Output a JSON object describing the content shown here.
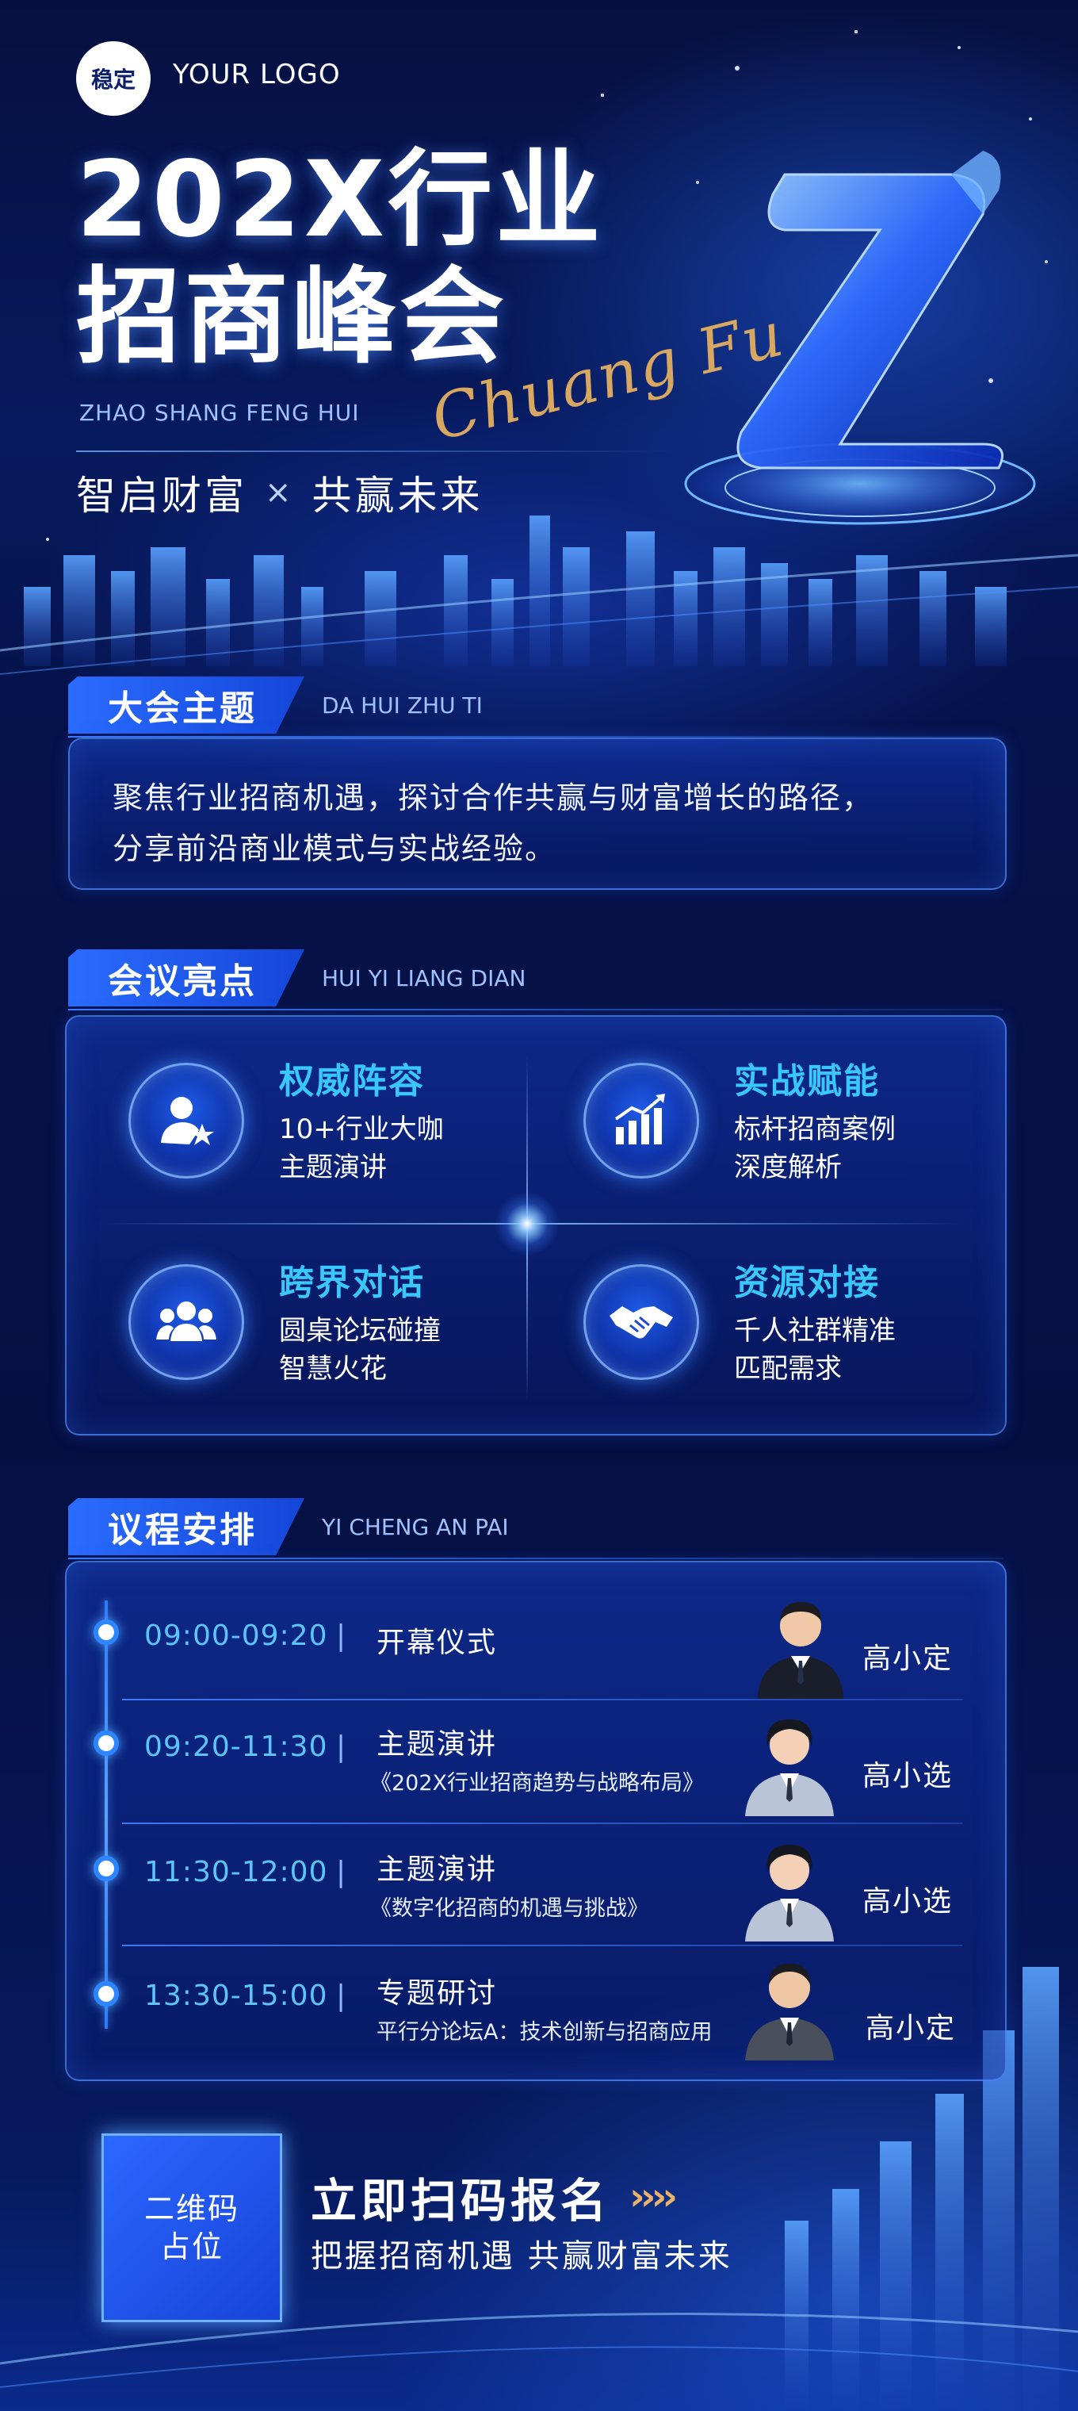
{
  "header": {
    "logo_badge": "稳定",
    "logo_text": "YOUR LOGO",
    "title_line1": "202X行业",
    "title_line2": "招商峰会",
    "pinyin": "ZHAO SHANG FENG HUI",
    "script_text": "Chuang Fu",
    "slogan_left": "智启财富",
    "slogan_sep": "×",
    "slogan_right": "共赢未来"
  },
  "theme": {
    "heading": "大会主题",
    "heading_pinyin": "DA HUI ZHU TI",
    "lines": [
      "聚焦行业招商机遇，探讨合作共赢与财富增长的路径，",
      "分享前沿商业模式与实战经验。"
    ]
  },
  "highlights": {
    "heading": "会议亮点",
    "heading_pinyin": "HUI YI LIANG DIAN",
    "items": [
      {
        "title": "权威阵容",
        "desc1": "10+行业大咖",
        "desc2": "主题演讲",
        "icon": "expert-star-icon"
      },
      {
        "title": "实战赋能",
        "desc1": "标杆招商案例",
        "desc2": "深度解析",
        "icon": "growth-chart-icon"
      },
      {
        "title": "跨界对话",
        "desc1": "圆桌论坛碰撞",
        "desc2": "智慧火花",
        "icon": "group-icon"
      },
      {
        "title": "资源对接",
        "desc1": "千人社群精准",
        "desc2": "匹配需求",
        "icon": "handshake-icon"
      }
    ]
  },
  "agenda": {
    "heading": "议程安排",
    "heading_pinyin": "YI CHENG AN PAI",
    "separator": "|",
    "items": [
      {
        "time": "09:00-09:20",
        "title": "开幕仪式",
        "subtitle": "",
        "speaker": "高小定"
      },
      {
        "time": "09:20-11:30",
        "title": "主题演讲",
        "subtitle": "《202X行业招商趋势与战略布局》",
        "speaker": "高小选"
      },
      {
        "time": "11:30-12:00",
        "title": "主题演讲",
        "subtitle": "《数字化招商的机遇与挑战》",
        "speaker": "高小选"
      },
      {
        "time": "13:30-15:00",
        "title": "专题研讨",
        "subtitle": "平行分论坛A：技术创新与招商应用",
        "speaker": "高小定"
      }
    ]
  },
  "cta": {
    "qr_line1": "二维码",
    "qr_line2": "占位",
    "title": "立即扫码报名",
    "arrows": "››››",
    "subtitle": "把握招商机遇  共赢财富未来"
  },
  "colors": {
    "background": "#040d3a",
    "accent_blue": "#2a6cff",
    "highlight_cyan": "#38c8ff",
    "time_blue": "#5cc4ff",
    "gold": "#d9a860"
  }
}
